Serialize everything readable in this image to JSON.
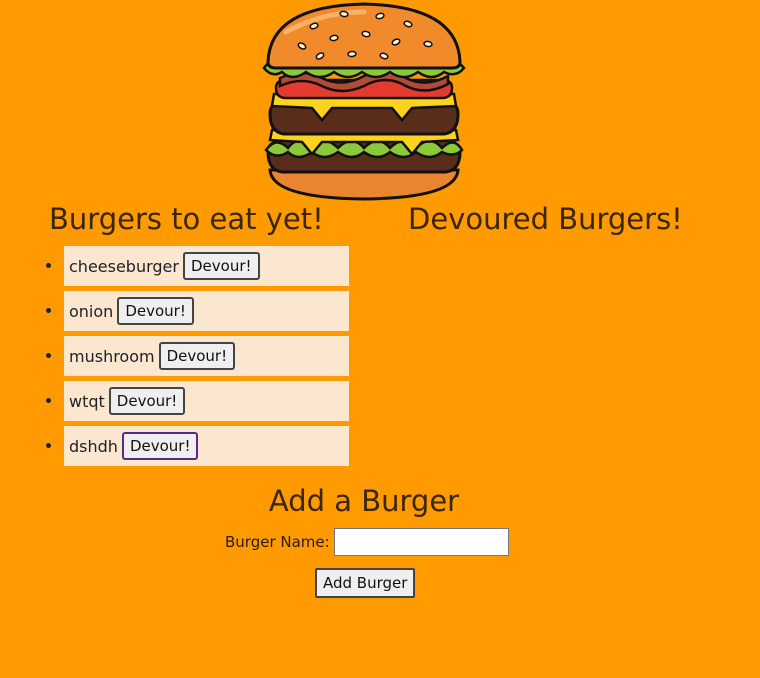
{
  "logo": {
    "icon": "burger-logo-icon"
  },
  "columns": {
    "to_eat_title": "Burgers to eat yet!",
    "devoured_title": "Devoured Burgers!"
  },
  "burgers_to_eat": [
    {
      "name": "cheeseburger",
      "button": "Devour!"
    },
    {
      "name": "onion",
      "button": "Devour!"
    },
    {
      "name": "mushroom",
      "button": "Devour!"
    },
    {
      "name": "wtqt",
      "button": "Devour!"
    },
    {
      "name": "dshdh",
      "button": "Devour!"
    }
  ],
  "devoured_burgers": [],
  "form": {
    "title": "Add a Burger",
    "label": "Burger Name:",
    "value": "",
    "placeholder": "",
    "submit_label": "Add Burger"
  },
  "colors": {
    "background": "#ff9a00",
    "list_item_background": "#fbe6d0",
    "focused_button_border": "#5a2a8a"
  }
}
